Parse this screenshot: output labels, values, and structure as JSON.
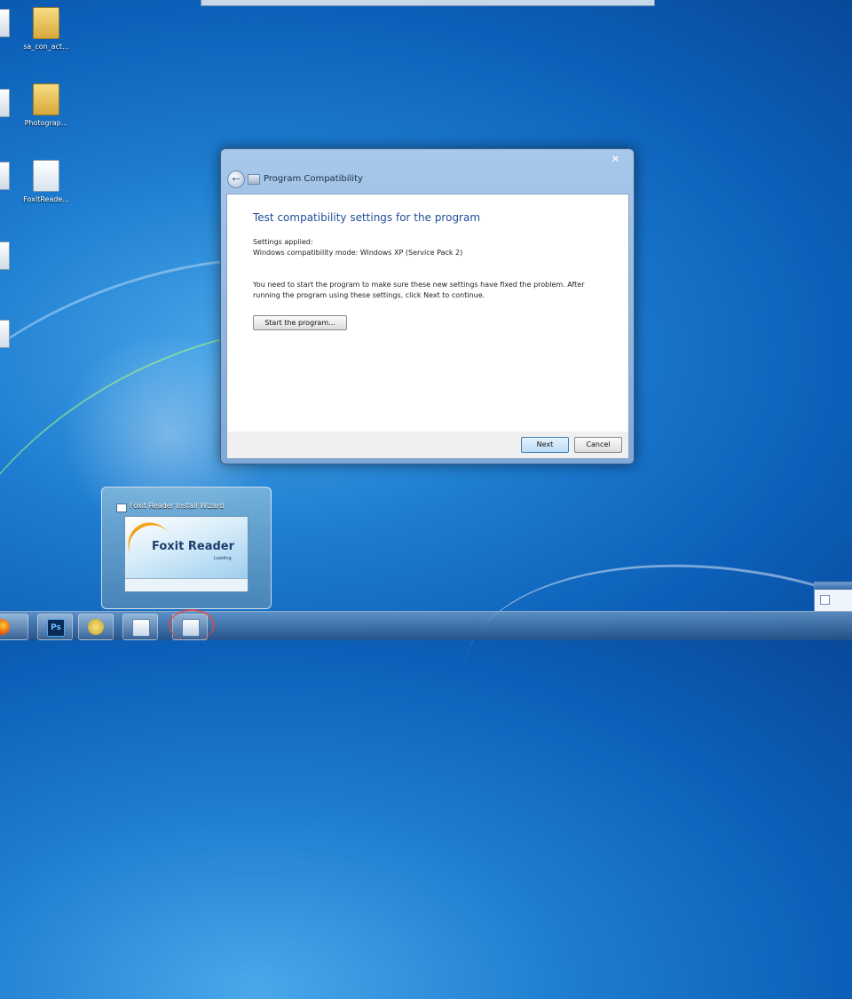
{
  "dialog": {
    "title": "Program Compatibility",
    "close_glyph": "×",
    "heading": "Test compatibility settings for the program",
    "settings_label": "Settings applied:",
    "settings_value": "Windows compatibility mode: Windows XP (Service Pack 2)",
    "instructions": "You need to start the program to make sure these new settings have fixed the problem. After running the program using these settings, click Next to continue.",
    "start_button": "Start the program...",
    "next_button": "Next",
    "cancel_button": "Cancel"
  },
  "desktop_icons": [
    {
      "label": "sa_con_act..."
    },
    {
      "label": "Photograp..."
    },
    {
      "label": "FoxitReade..."
    }
  ],
  "preview": {
    "title": "Foxit Reader Install Wizard",
    "thumb_title": "Foxit Reader",
    "thumb_sub": "Loading"
  },
  "taskbar": {
    "ps_label": "Ps"
  },
  "icons": {
    "back": "back-arrow-icon",
    "wizard": "program-compatibility-icon",
    "firefox": "firefox-icon",
    "photoshop": "photoshop-icon",
    "keys": "keys-icon",
    "foxit": "foxit-installer-icon",
    "compat": "compatibility-wizard-icon"
  },
  "colors": {
    "heading": "#1f4e97",
    "next_border": "#3c7fb1"
  }
}
